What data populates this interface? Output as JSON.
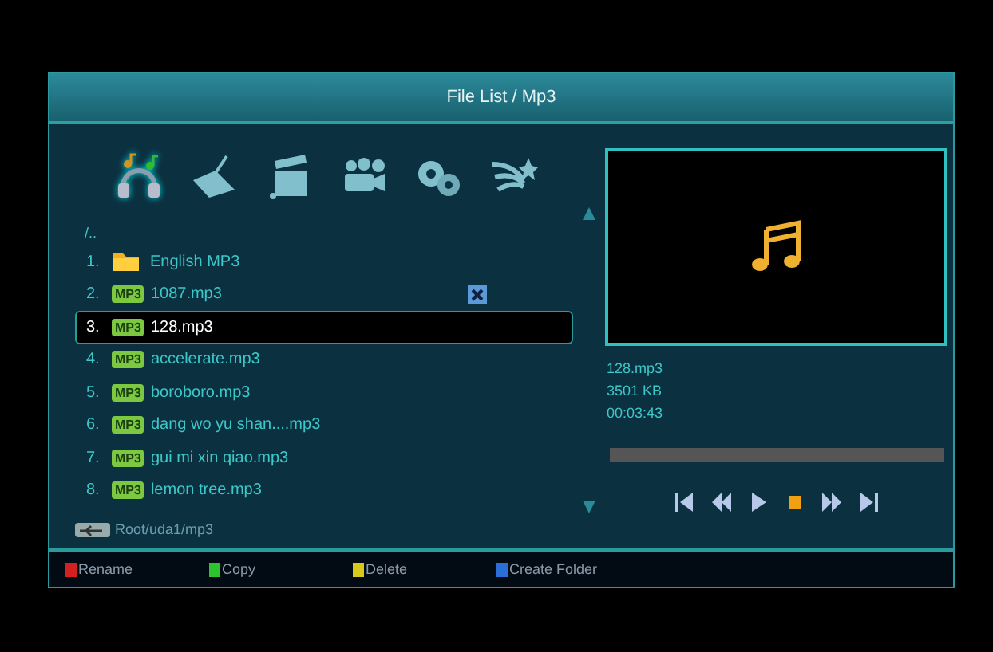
{
  "window": {
    "title": "File List / Mp3"
  },
  "categories": [
    {
      "kind": "music",
      "selected": true
    },
    {
      "kind": "photo",
      "selected": false
    },
    {
      "kind": "movie",
      "selected": false
    },
    {
      "kind": "record",
      "selected": false
    },
    {
      "kind": "settings",
      "selected": false
    },
    {
      "kind": "game",
      "selected": false
    }
  ],
  "parent": "/..",
  "files": [
    {
      "number": "1.",
      "kind": "folder",
      "name": "English MP3",
      "selected": false,
      "marked": false
    },
    {
      "number": "2.",
      "kind": "mp3",
      "badge": "MP3",
      "name": "1087.mp3",
      "selected": false,
      "marked": true
    },
    {
      "number": "3.",
      "kind": "mp3",
      "badge": "MP3",
      "name": "128.mp3",
      "selected": true,
      "marked": false
    },
    {
      "number": "4.",
      "kind": "mp3",
      "badge": "MP3",
      "name": "accelerate.mp3",
      "selected": false,
      "marked": false
    },
    {
      "number": "5.",
      "kind": "mp3",
      "badge": "MP3",
      "name": "boroboro.mp3",
      "selected": false,
      "marked": false
    },
    {
      "number": "6.",
      "kind": "mp3",
      "badge": "MP3",
      "name": "dang wo yu shan....mp3",
      "selected": false,
      "marked": false
    },
    {
      "number": "7.",
      "kind": "mp3",
      "badge": "MP3",
      "name": "gui mi xin qiao.mp3",
      "selected": false,
      "marked": false
    },
    {
      "number": "8.",
      "kind": "mp3",
      "badge": "MP3",
      "name": "lemon tree.mp3",
      "selected": false,
      "marked": false
    }
  ],
  "path": "Root/uda1/mp3",
  "info": {
    "name": "128.mp3",
    "size": "3501 KB",
    "duration": "00:03:43"
  },
  "progress": {
    "level": 0
  },
  "controls": [
    {
      "kind": "prev",
      "active": false
    },
    {
      "kind": "rewind",
      "active": false
    },
    {
      "kind": "play",
      "active": false
    },
    {
      "kind": "stop",
      "active": true
    },
    {
      "kind": "forward",
      "active": false
    },
    {
      "kind": "next",
      "active": false
    }
  ],
  "keys": [
    {
      "label": "Rename",
      "color": "#d42020"
    },
    {
      "label": "Copy",
      "color": "#2ec42e"
    },
    {
      "label": "Delete",
      "color": "#d8c81c"
    },
    {
      "label": "Create Folder",
      "color": "#2a6ed8"
    }
  ]
}
